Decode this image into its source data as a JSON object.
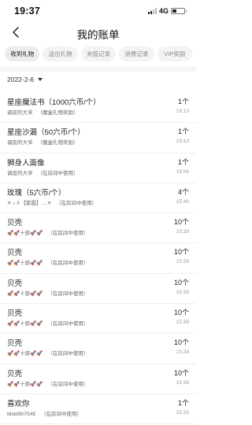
{
  "status_bar": {
    "time": "19:37",
    "network": "4G"
  },
  "nav": {
    "title": "我的账单"
  },
  "tabs": [
    {
      "label": "收到礼物",
      "active": true
    },
    {
      "label": "送出礼物",
      "active": false
    },
    {
      "label": "充值记录",
      "active": false
    },
    {
      "label": "消费记录",
      "active": false
    },
    {
      "label": "VIP奖励",
      "active": false
    }
  ],
  "date_filter": {
    "value": "2022-2-6"
  },
  "records": [
    {
      "title": "星座魔法书（1000六币/个）",
      "sender": "调皮的大爷",
      "note": "（魔盒礼物奖励）",
      "count": "1个",
      "time": "19:13"
    },
    {
      "title": "星座沙漏（50六币/个）",
      "sender": "调皮的大爷",
      "note": "（魔盒礼物奖励）",
      "count": "1个",
      "time": "19:13"
    },
    {
      "title": "狮身人面像",
      "sender": "调皮的大爷",
      "note": "（在房间中使用）",
      "count": "1个",
      "time": "19:06"
    },
    {
      "title": "玫瑰（5六币/个）",
      "sender": "✳︎ ♪ /l 【紫霞】....✳︎",
      "note": "（在房间中使用）",
      "count": "4个",
      "time": "15:40"
    },
    {
      "title": "贝壳",
      "sender": "🚀🚀十部🚀🚀",
      "note": "（在房间中使用）",
      "count": "10个",
      "time": "15:39"
    },
    {
      "title": "贝壳",
      "sender": "🚀🚀十部🚀🚀",
      "note": "（在房间中使用）",
      "count": "10个",
      "time": "15:39"
    },
    {
      "title": "贝壳",
      "sender": "🚀🚀十部🚀🚀",
      "note": "（在房间中使用）",
      "count": "10个",
      "time": "15:39"
    },
    {
      "title": "贝壳",
      "sender": "🚀🚀十部🚀🚀",
      "note": "（在房间中使用）",
      "count": "10个",
      "time": "15:39"
    },
    {
      "title": "贝壳",
      "sender": "🚀🚀十部🚀🚀",
      "note": "（在房间中使用）",
      "count": "10个",
      "time": "15:38"
    },
    {
      "title": "贝壳",
      "sender": "🚀🚀十部🚀🚀",
      "note": "（在房间中使用）",
      "count": "10个",
      "time": "15:38"
    },
    {
      "title": "喜欢你",
      "sender": "Mobf90754E",
      "note": "（在房间中使用）",
      "count": "1个",
      "time": "15:35"
    }
  ]
}
